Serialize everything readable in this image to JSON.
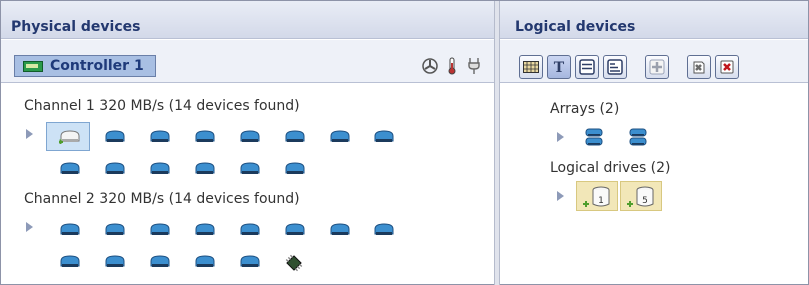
{
  "panels": {
    "physical_title": "Physical devices",
    "logical_title": "Logical devices"
  },
  "controller": {
    "label": "Controller 1",
    "icon": "controller-card-icon"
  },
  "status_icons": [
    "fan-icon",
    "temperature-icon",
    "power-plug-icon"
  ],
  "toolbar": {
    "buttons": [
      {
        "icon": "grid-view-icon"
      },
      {
        "icon": "text-view-icon",
        "glyph": "T",
        "selected": true
      },
      {
        "icon": "list-view-icon"
      },
      {
        "icon": "detail-view-icon"
      },
      {
        "icon": "add-icon"
      },
      {
        "icon": "properties-icon"
      },
      {
        "icon": "delete-icon"
      }
    ]
  },
  "channels": [
    {
      "label": "Channel 1  320 MB/s (14 devices found)",
      "devices": 14
    },
    {
      "label": "Channel 2  320 MB/s (14 devices found)",
      "devices": 14
    }
  ],
  "logical": {
    "arrays_label": "Arrays (2)",
    "arrays_count": 2,
    "drives_label": "Logical drives (2)",
    "drives": [
      {
        "raid": "1"
      },
      {
        "raid": "5"
      }
    ]
  },
  "colors": {
    "title_text": "#23386f",
    "disk_blue": "#3c8fcf",
    "selection": "#a8bfe3",
    "logical_drive_bg": "#f2e7b8"
  }
}
